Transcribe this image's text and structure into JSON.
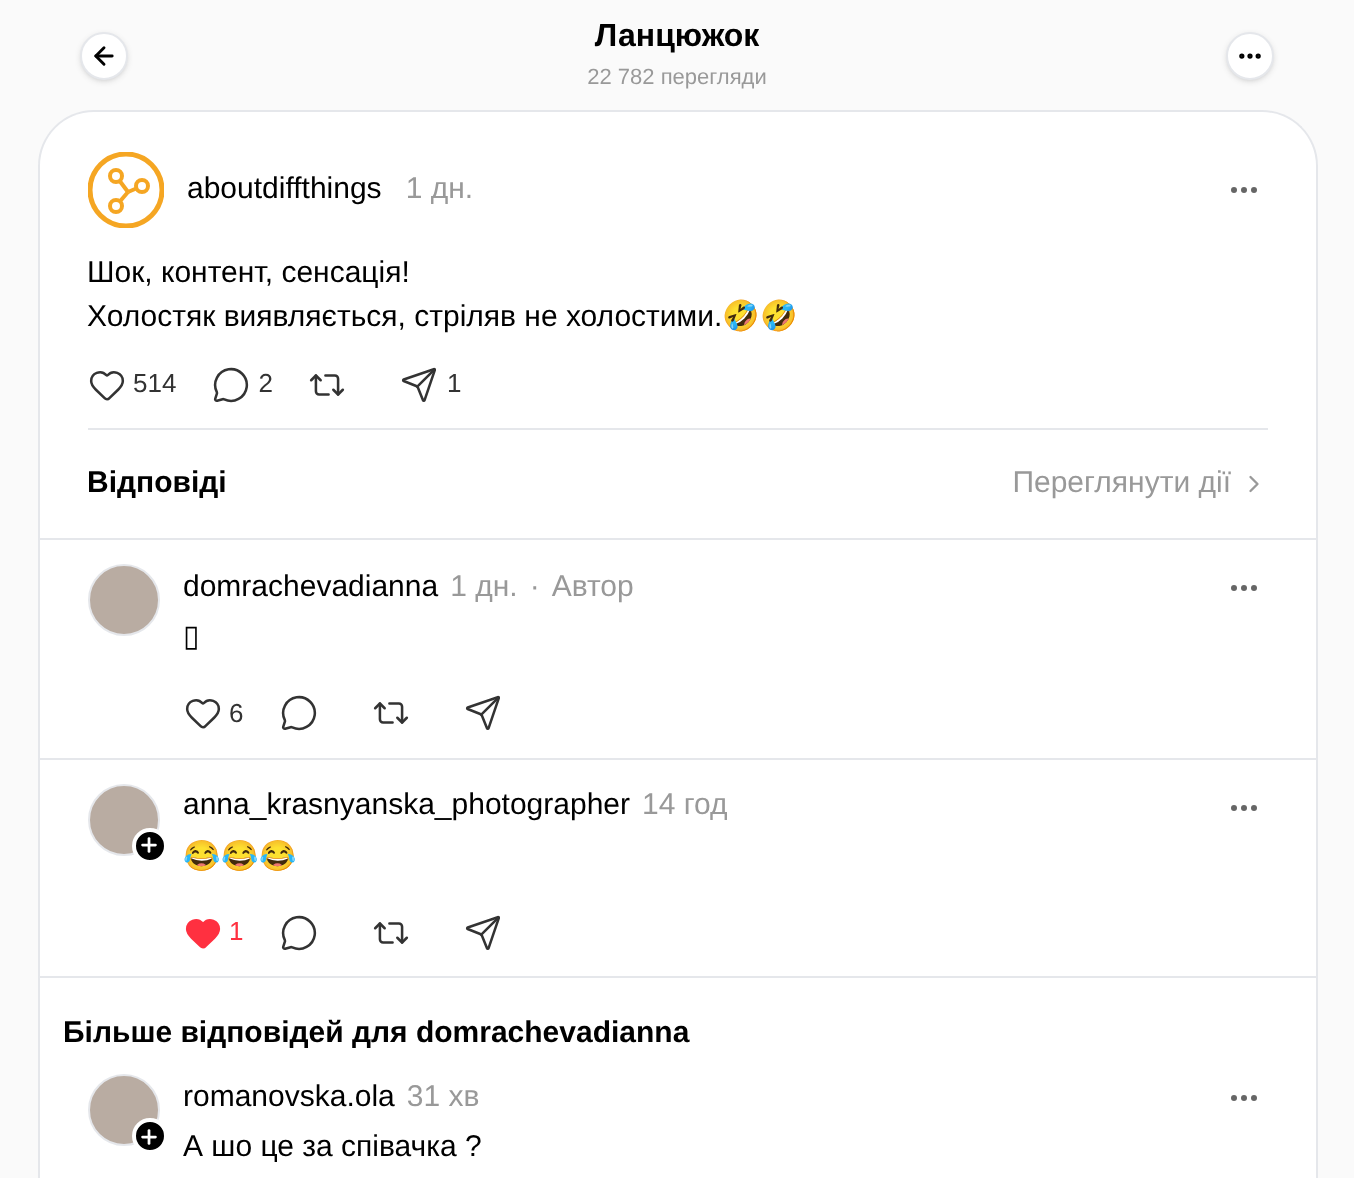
{
  "header": {
    "title": "Ланцюжок",
    "views": "22 782 перегляди"
  },
  "post": {
    "author": "aboutdiffthings",
    "time": "1 дн.",
    "lines": [
      "Шок, контент, сенсація!",
      "Холостяк виявляється, стріляв не холостими.🤣🤣"
    ],
    "actions": {
      "liked": false,
      "likes": "514",
      "comments": "2",
      "shares": "1"
    }
  },
  "replies_header": {
    "title": "Відповіді",
    "link": "Переглянути дії"
  },
  "replies": [
    {
      "author": "domrachevadianna",
      "time": "1 дн.",
      "separator": "·",
      "tag": "Автор",
      "text": "▯",
      "follow": false,
      "actions": {
        "liked": false,
        "likes": "6"
      }
    },
    {
      "author": "anna_krasnyanska_photographer",
      "time": "14 год",
      "text": "😂😂😂",
      "follow": true,
      "actions": {
        "liked": true,
        "likes": "1"
      }
    }
  ],
  "more_replies": {
    "title": "Більше відповідей для domrachevadianna",
    "replies": [
      {
        "author": "romanovska.ola",
        "time": "31 хв",
        "text": "А шо це за співачка ?",
        "follow": true
      }
    ]
  }
}
